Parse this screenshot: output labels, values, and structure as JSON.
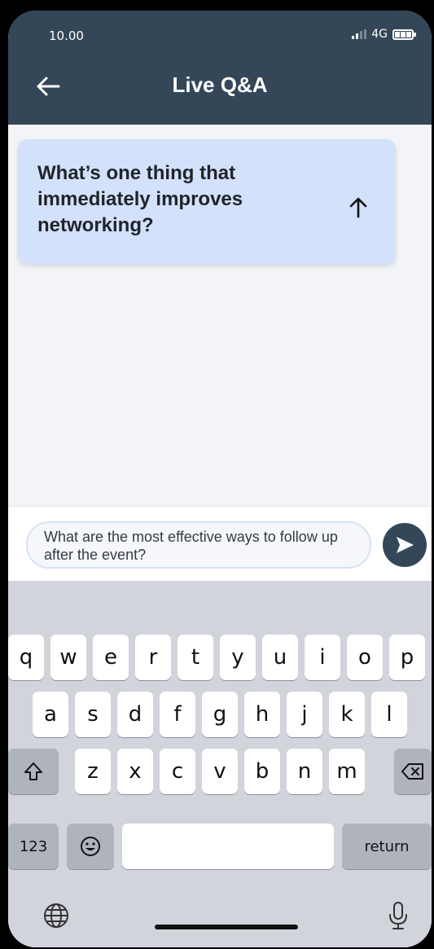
{
  "status_bar": {
    "time": "10.00",
    "network": "4G"
  },
  "header": {
    "title": "Live Q&A"
  },
  "question_card": {
    "text": "What’s one thing that immediately improves networking?"
  },
  "composer": {
    "value": "What are the most effective ways to follow up after the event?"
  },
  "keyboard": {
    "row1": [
      "q",
      "w",
      "e",
      "r",
      "t",
      "y",
      "u",
      "i",
      "o",
      "p"
    ],
    "row2": [
      "a",
      "s",
      "d",
      "f",
      "g",
      "h",
      "j",
      "k",
      "l"
    ],
    "row3": [
      "z",
      "x",
      "c",
      "v",
      "b",
      "n",
      "m"
    ],
    "numbers_label": "123",
    "return_label": "return"
  },
  "colors": {
    "header": "#344759",
    "card": "#d3e1fb",
    "keyboard": "#d1d4da"
  }
}
